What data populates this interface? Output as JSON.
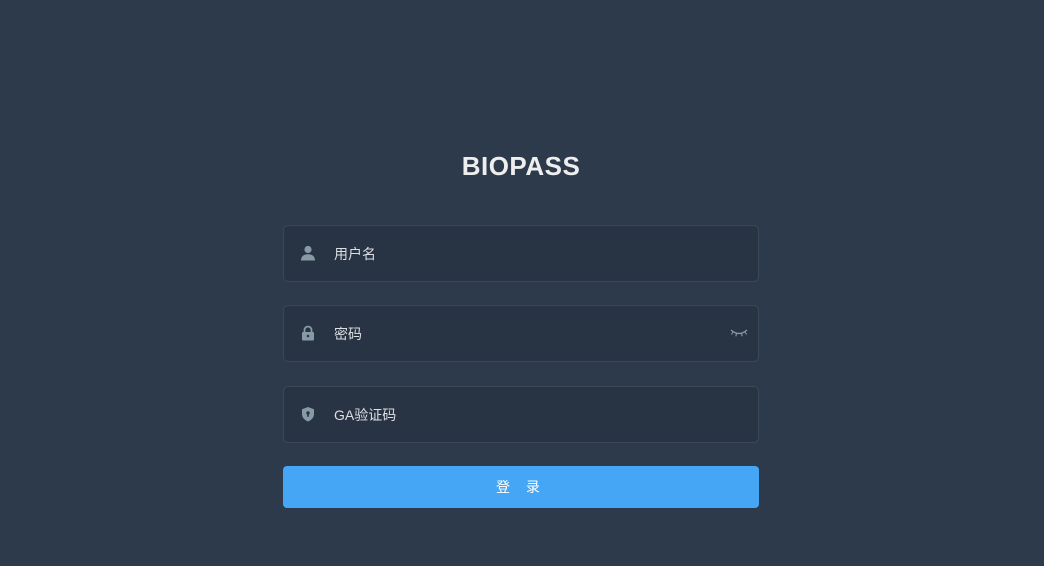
{
  "app": {
    "title": "BIOPASS"
  },
  "form": {
    "username": {
      "placeholder": "用户名",
      "value": ""
    },
    "password": {
      "placeholder": "密码",
      "value": ""
    },
    "ga_code": {
      "placeholder": "GA验证码",
      "value": ""
    },
    "submit_label": "登 录"
  },
  "icons": {
    "username": "user-icon",
    "password": "lock-icon",
    "ga_code": "shield-icon",
    "toggle": "eye-closed-icon"
  },
  "colors": {
    "background": "#2d3a4b",
    "field_background": "#283443",
    "accent": "#46a6f6",
    "title": "#eeeeee"
  }
}
